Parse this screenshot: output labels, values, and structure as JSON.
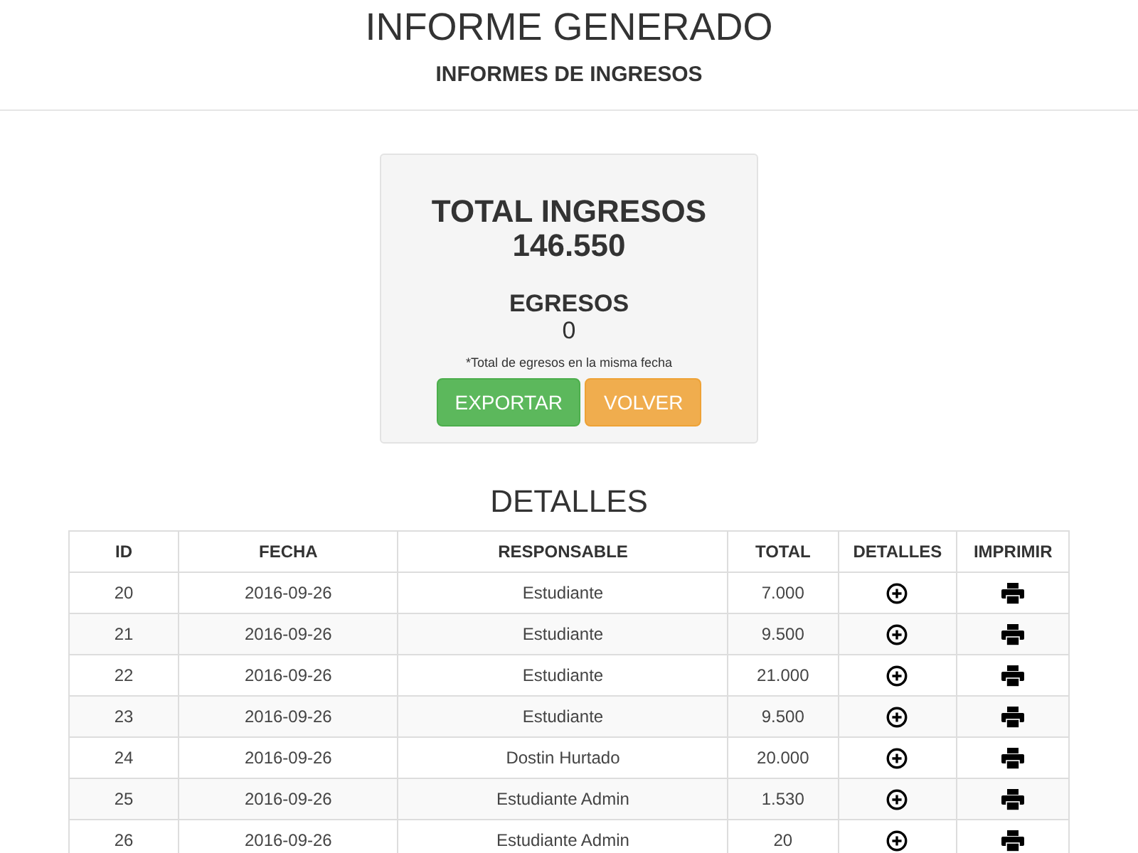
{
  "header": {
    "title": "INFORME GENERADO",
    "subtitle": "INFORMES DE INGRESOS"
  },
  "summary": {
    "total_label": "TOTAL INGRESOS",
    "total_value": "146.550",
    "egresos_label": "EGRESOS",
    "egresos_value": "0",
    "note": "*Total de egresos en la misma fecha",
    "buttons": [
      {
        "label": "EXPORTAR",
        "kind": "success"
      },
      {
        "label": "VOLVER",
        "kind": "warning"
      }
    ]
  },
  "details": {
    "title": "DETALLES",
    "columns": [
      "ID",
      "FECHA",
      "RESPONSABLE",
      "TOTAL",
      "DETALLES",
      "IMPRIMIR"
    ],
    "rows": [
      {
        "id": "20",
        "fecha": "2016-09-26",
        "responsable": "Estudiante",
        "total": "7.000"
      },
      {
        "id": "21",
        "fecha": "2016-09-26",
        "responsable": "Estudiante",
        "total": "9.500"
      },
      {
        "id": "22",
        "fecha": "2016-09-26",
        "responsable": "Estudiante",
        "total": "21.000"
      },
      {
        "id": "23",
        "fecha": "2016-09-26",
        "responsable": "Estudiante",
        "total": "9.500"
      },
      {
        "id": "24",
        "fecha": "2016-09-26",
        "responsable": "Dostin Hurtado",
        "total": "20.000"
      },
      {
        "id": "25",
        "fecha": "2016-09-26",
        "responsable": "Estudiante Admin",
        "total": "1.530"
      },
      {
        "id": "26",
        "fecha": "2016-09-26",
        "responsable": "Estudiante Admin",
        "total": "20"
      }
    ]
  }
}
